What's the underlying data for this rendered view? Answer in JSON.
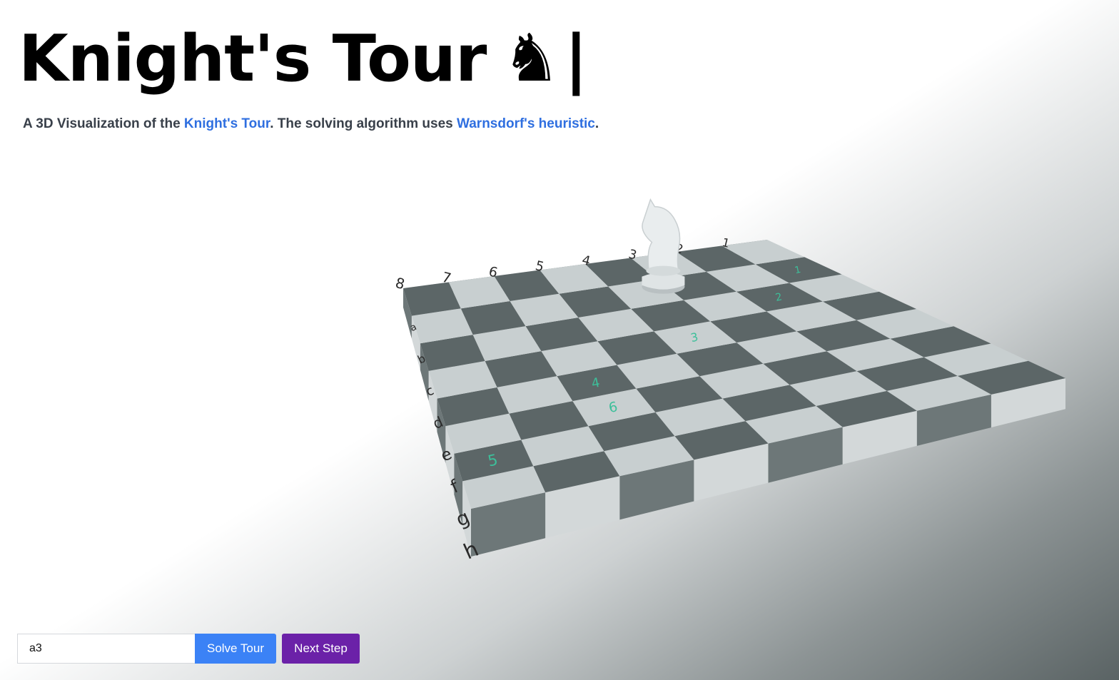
{
  "header": {
    "title": "Knight's Tour",
    "title_icon": "♞",
    "title_cursor": "|"
  },
  "subtitle": {
    "prefix": "A 3D Visualization of the ",
    "link1": "Knight's Tour",
    "middle": ". The solving algorithm uses ",
    "link2": "Warnsdorf's heuristic",
    "suffix": "."
  },
  "board": {
    "rank_labels": [
      "1",
      "2",
      "3",
      "4",
      "5",
      "6",
      "7",
      "8"
    ],
    "file_labels": [
      "a",
      "b",
      "c",
      "d",
      "e",
      "f",
      "g",
      "h"
    ],
    "knight_square": "a3",
    "move_markers": [
      {
        "label": "1",
        "square": "b1"
      },
      {
        "label": "2",
        "square": "c2"
      },
      {
        "label": "3",
        "square": "d4"
      },
      {
        "label": "4",
        "square": "e6"
      },
      {
        "label": "5",
        "square": "g8"
      },
      {
        "label": "6",
        "square": "f6"
      }
    ],
    "colors": {
      "light_square": "#c8cfd0",
      "dark_square": "#5c6667",
      "light_side": "#d3d8d9",
      "dark_side": "#6d7778",
      "marker": "#3dbf9a",
      "knight": "#e9edee"
    }
  },
  "controls": {
    "start_value": "a3",
    "solve_label": "Solve Tour",
    "next_label": "Next Step"
  }
}
